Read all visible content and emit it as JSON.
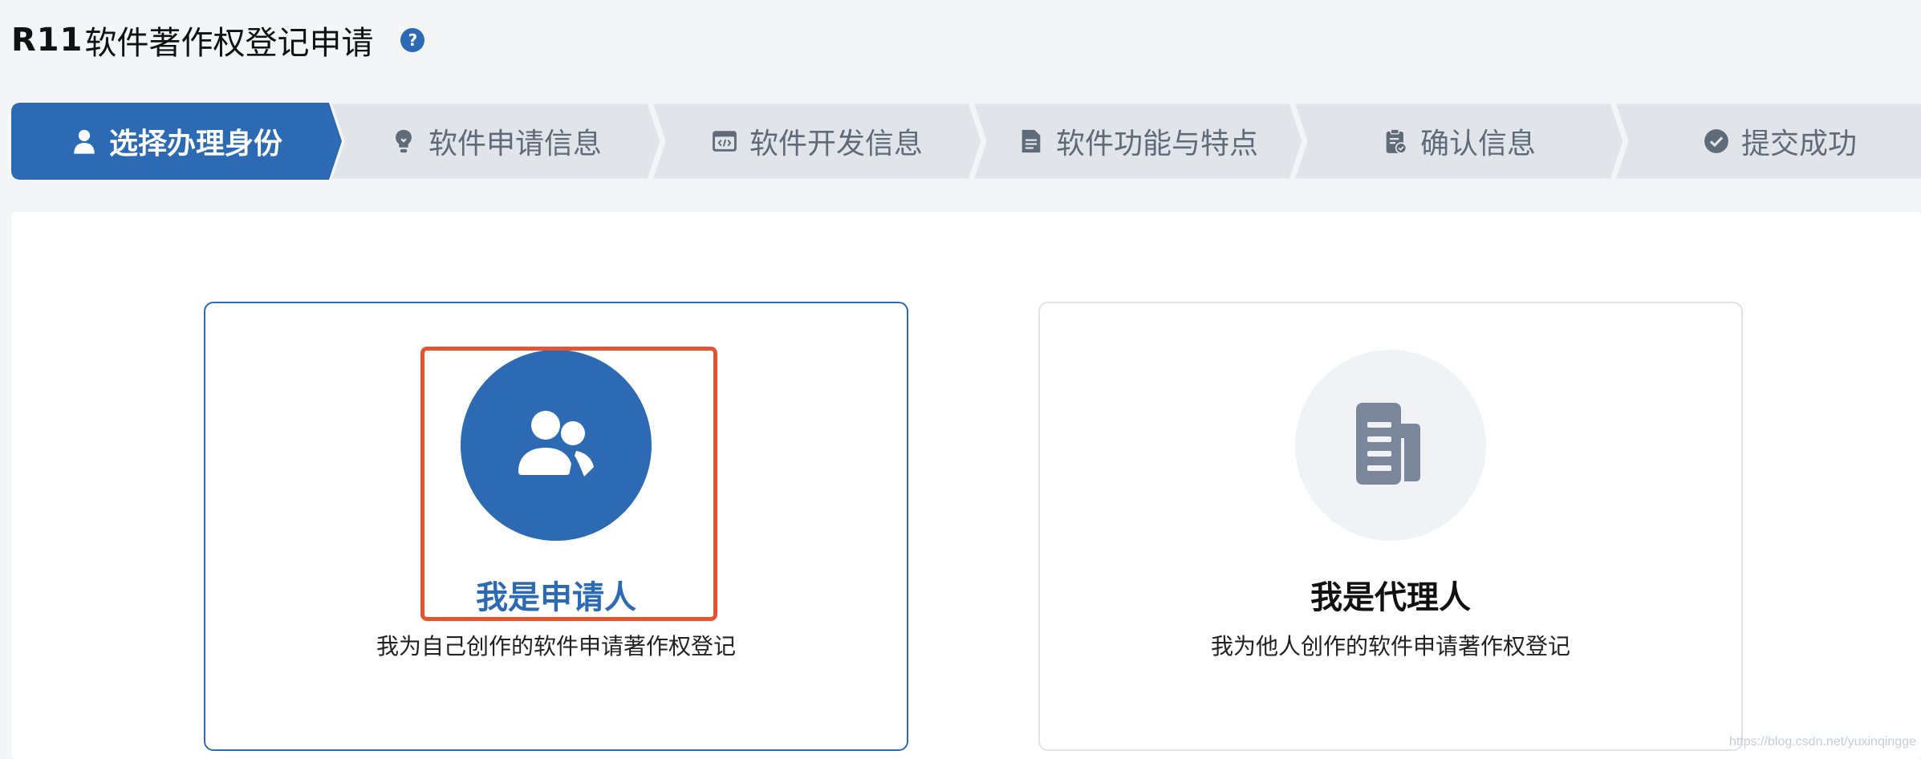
{
  "header": {
    "title_prefix": "R11",
    "title_text": "软件著作权登记申请",
    "help_icon": "question-circle-icon",
    "help_glyph": "?"
  },
  "steps": [
    {
      "label": "选择办理身份",
      "icon": "user-icon",
      "active": true
    },
    {
      "label": "软件申请信息",
      "icon": "lightbulb-icon",
      "active": false
    },
    {
      "label": "软件开发信息",
      "icon": "code-window-icon",
      "active": false
    },
    {
      "label": "软件功能与特点",
      "icon": "document-icon",
      "active": false
    },
    {
      "label": "确认信息",
      "icon": "clipboard-check-icon",
      "active": false
    },
    {
      "label": "提交成功",
      "icon": "check-circle-icon",
      "active": false
    }
  ],
  "options": {
    "applicant": {
      "title": "我是申请人",
      "description": "我为自己创作的软件申请著作权登记",
      "icon": "users-icon",
      "selected": true
    },
    "agent": {
      "title": "我是代理人",
      "description": "我为他人创作的软件申请著作权登记",
      "icon": "documents-icon",
      "selected": false
    }
  },
  "watermark": "https://blog.csdn.net/yuxinqingge",
  "colors": {
    "accent": "#2c6ab4",
    "step_inactive_bg": "#e1e5ea",
    "step_inactive_text": "#5f6b78",
    "highlight": "#e8532f",
    "agent_icon": "#7a879a"
  }
}
